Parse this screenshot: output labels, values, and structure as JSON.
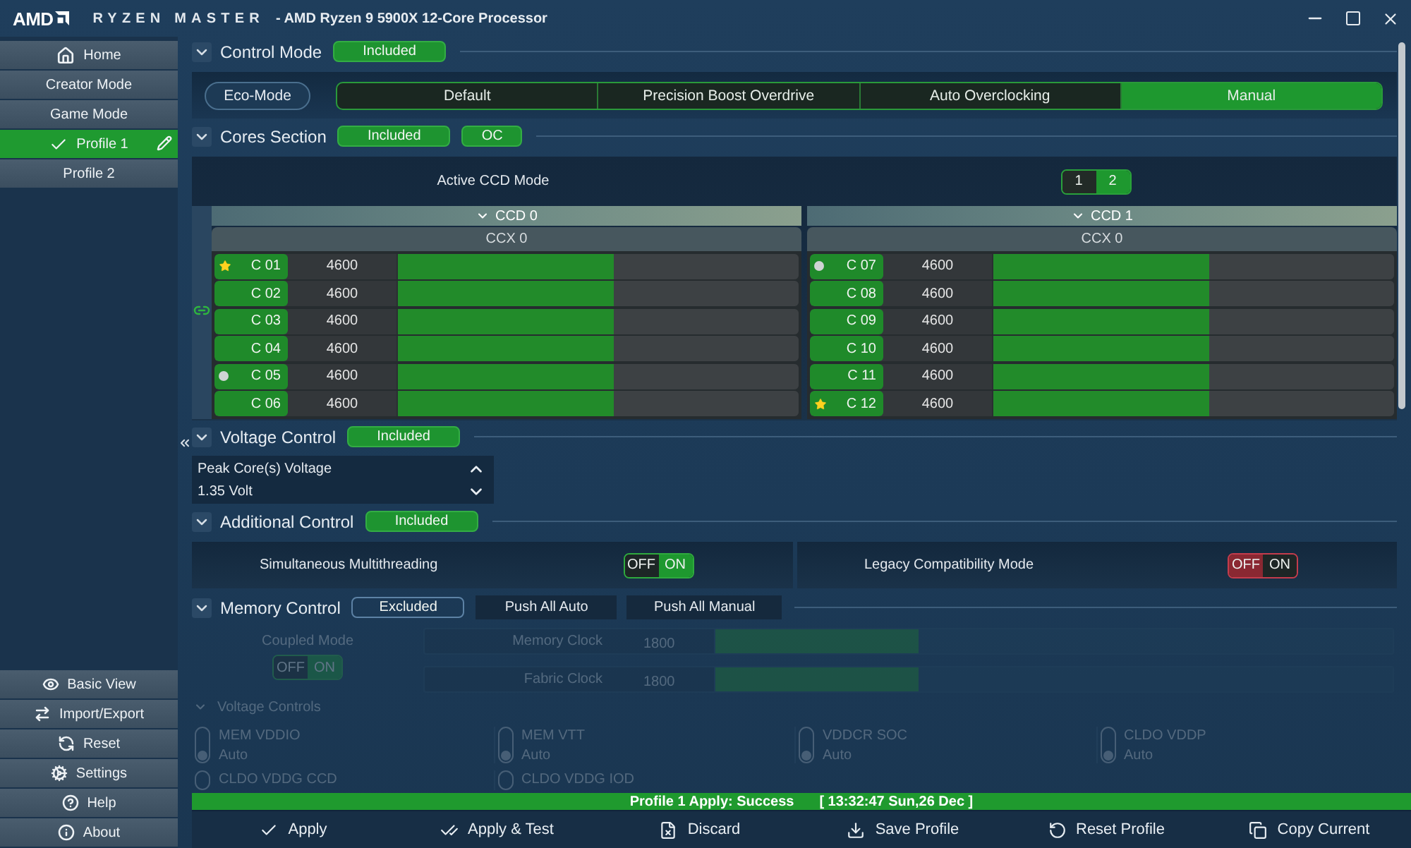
{
  "window": {
    "logo": "AMD",
    "app_name": "RYZEN MASTER",
    "title": "- AMD Ryzen 9 5900X 12-Core Processor"
  },
  "sidebar": {
    "items": [
      {
        "label": "Home",
        "kind": "home",
        "selected": false
      },
      {
        "label": "Creator Mode",
        "kind": "mode",
        "selected": false
      },
      {
        "label": "Game Mode",
        "kind": "mode",
        "selected": false
      },
      {
        "label": "Profile 1",
        "kind": "profile",
        "selected": true
      },
      {
        "label": "Profile 2",
        "kind": "profile",
        "selected": false
      }
    ],
    "bottom_items": [
      "Basic View",
      "Import/Export",
      "Reset",
      "Settings",
      "Help",
      "About"
    ]
  },
  "control_mode": {
    "title": "Control Mode",
    "expanded": true,
    "badges": [
      {
        "label": "Included",
        "on": true
      }
    ],
    "eco_mode": "Eco-Mode",
    "modes": [
      {
        "label": "Default",
        "selected": false
      },
      {
        "label": "Precision Boost Overdrive",
        "selected": false
      },
      {
        "label": "Auto Overclocking",
        "selected": false
      },
      {
        "label": "Manual",
        "selected": true
      }
    ]
  },
  "cores_section": {
    "title": "Cores Section",
    "expanded": true,
    "badges": [
      {
        "label": "Included",
        "on": true
      },
      {
        "label": "OC",
        "on": true
      }
    ],
    "active_ccd_mode": {
      "label": "Active CCD Mode",
      "options": [
        {
          "label": "1",
          "selected": false
        },
        {
          "label": "2",
          "selected": true
        }
      ]
    },
    "ccds": [
      {
        "name": "CCD 0",
        "expanded": true,
        "ccx": "CCX 0",
        "cores": [
          {
            "label": "C 01",
            "frequency": "4600",
            "level": 0.54,
            "star": true,
            "dot": false
          },
          {
            "label": "C 02",
            "frequency": "4600",
            "level": 0.54,
            "star": false,
            "dot": false
          },
          {
            "label": "C 03",
            "frequency": "4600",
            "level": 0.54,
            "star": false,
            "dot": false
          },
          {
            "label": "C 04",
            "frequency": "4600",
            "level": 0.54,
            "star": false,
            "dot": false
          },
          {
            "label": "C 05",
            "frequency": "4600",
            "level": 0.54,
            "star": false,
            "dot": true
          },
          {
            "label": "C 06",
            "frequency": "4600",
            "level": 0.54,
            "star": false,
            "dot": false
          }
        ]
      },
      {
        "name": "CCD 1",
        "expanded": true,
        "ccx": "CCX 0",
        "cores": [
          {
            "label": "C 07",
            "frequency": "4600",
            "level": 0.54,
            "star": false,
            "dot": true
          },
          {
            "label": "C 08",
            "frequency": "4600",
            "level": 0.54,
            "star": false,
            "dot": false
          },
          {
            "label": "C 09",
            "frequency": "4600",
            "level": 0.54,
            "star": false,
            "dot": false
          },
          {
            "label": "C 10",
            "frequency": "4600",
            "level": 0.54,
            "star": false,
            "dot": false
          },
          {
            "label": "C 11",
            "frequency": "4600",
            "level": 0.54,
            "star": false,
            "dot": false
          },
          {
            "label": "C 12",
            "frequency": "4600",
            "level": 0.54,
            "star": true,
            "dot": false
          }
        ]
      }
    ]
  },
  "voltage_control": {
    "title": "Voltage Control",
    "expanded": true,
    "badges": [
      {
        "label": "Included",
        "on": true
      }
    ],
    "label": "Peak Core(s) Voltage",
    "value": "1.35 Volt"
  },
  "additional_control": {
    "title": "Additional Control",
    "expanded": true,
    "badges": [
      {
        "label": "Included",
        "on": true
      }
    ],
    "toggles": [
      {
        "label": "Simultaneous Multithreading",
        "off_label": "OFF",
        "on_label": "ON",
        "on": true
      },
      {
        "label": "Legacy Compatibility Mode",
        "off_label": "OFF",
        "on_label": "ON",
        "on": false
      }
    ]
  },
  "memory_control": {
    "title": "Memory Control",
    "expanded": true,
    "badges": [
      {
        "label": "Excluded",
        "on": false
      }
    ],
    "buttons": [
      "Push All Auto",
      "Push All Manual"
    ],
    "disabled": true,
    "coupled_mode": {
      "label": "Coupled Mode",
      "off_label": "OFF",
      "on_label": "ON",
      "on": true
    },
    "clocks": [
      {
        "label": "Memory Clock",
        "value": "1800",
        "level": 0.3
      },
      {
        "label": "Fabric Clock",
        "value": "1800",
        "level": 0.3
      }
    ],
    "voltage_controls": {
      "title": "Voltage Controls",
      "expanded": true,
      "items": [
        {
          "label": "MEM VDDIO",
          "value": "Auto"
        },
        {
          "label": "MEM VTT",
          "value": "Auto"
        },
        {
          "label": "VDDCR SOC",
          "value": "Auto"
        },
        {
          "label": "CLDO VDDP",
          "value": "Auto"
        },
        {
          "label": "CLDO VDDG CCD"
        },
        {
          "label": "CLDO VDDG IOD"
        }
      ]
    }
  },
  "status_bar": {
    "message": "Profile 1 Apply: Success",
    "timestamp": "[ 13:32:47 Sun,26 Dec ]"
  },
  "toolbar": [
    "Apply",
    "Apply & Test",
    "Discard",
    "Save Profile",
    "Reset Profile",
    "Copy Current"
  ]
}
